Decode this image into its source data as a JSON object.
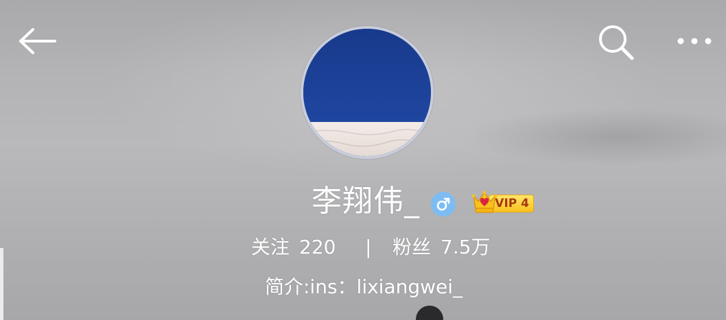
{
  "header": {
    "back_icon": "arrow-left-icon",
    "search_icon": "search-icon",
    "more_icon": "more-horizontal-icon"
  },
  "profile": {
    "name": "李翔伟_",
    "gender_icon": "male-icon",
    "vip_icon": "crown-icon",
    "vip_label": "VIP 4",
    "stats": {
      "following_label": "关注",
      "following_count": "220",
      "divider": "|",
      "followers_label": "粉丝",
      "followers_count": "7.5万"
    },
    "bio": "简介:ins：lixiangwei_"
  },
  "colors": {
    "avatar_top": "#1a3d8f",
    "avatar_bottom": "#ece4e0",
    "gender_badge": "#7dbcf2",
    "vip_gold": "#f9c21c",
    "vip_text": "#a5390e",
    "crown_red": "#d7263d"
  }
}
